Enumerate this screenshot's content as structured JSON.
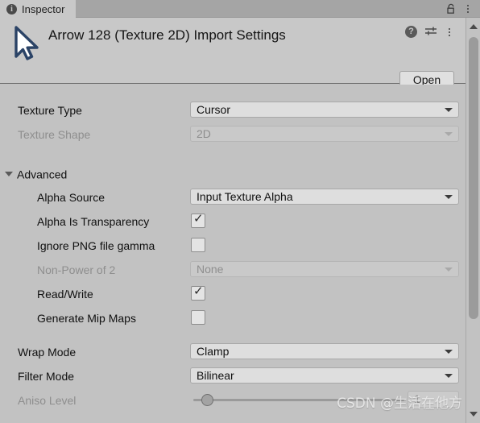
{
  "window": {
    "tab_label": "Inspector",
    "info_icon": "info-icon",
    "lock_icon": "lock-icon",
    "menu_icon": "kebab-menu-icon"
  },
  "header": {
    "title": "Arrow 128 (Texture 2D) Import Settings",
    "asset_icon": "cursor-arrow-icon",
    "help_icon": "help-icon",
    "preset_icon": "preset-sliders-icon",
    "menu_icon": "kebab-menu-icon",
    "open_label": "Open"
  },
  "fields": {
    "texture_type": {
      "label": "Texture Type",
      "value": "Cursor",
      "disabled": false
    },
    "texture_shape": {
      "label": "Texture Shape",
      "value": "2D",
      "disabled": true
    },
    "advanced": {
      "label": "Advanced",
      "expanded": true
    },
    "alpha_source": {
      "label": "Alpha Source",
      "value": "Input Texture Alpha",
      "disabled": false
    },
    "alpha_is_transparency": {
      "label": "Alpha Is Transparency",
      "checked": true,
      "check_glyph": "✓"
    },
    "ignore_png_gamma": {
      "label": "Ignore PNG file gamma",
      "checked": false,
      "check_glyph": ""
    },
    "non_power_of_2": {
      "label": "Non-Power of 2",
      "value": "None",
      "disabled": true
    },
    "read_write": {
      "label": "Read/Write",
      "checked": true,
      "check_glyph": "✓"
    },
    "generate_mip_maps": {
      "label": "Generate Mip Maps",
      "checked": false,
      "check_glyph": ""
    },
    "wrap_mode": {
      "label": "Wrap Mode",
      "value": "Clamp",
      "disabled": false
    },
    "filter_mode": {
      "label": "Filter Mode",
      "value": "Bilinear",
      "disabled": false
    },
    "aniso_level": {
      "label": "Aniso Level",
      "value": "1",
      "disabled": true
    }
  },
  "scrollbar": {
    "up_arrow": "scroll-up-arrow",
    "down_arrow": "scroll-down-arrow"
  },
  "watermark": {
    "text": "CSDN @生活在他方"
  },
  "colors": {
    "window_bg": "#c2c2c2",
    "header_bg": "#c8c8c8",
    "tabbar_bg": "#a5a5a5",
    "field_bg": "#dedede",
    "field_disabled_bg": "#c9c9c9",
    "text": "#101010",
    "text_disabled": "#8e8e8e",
    "cursor_outline": "#2b4366"
  }
}
